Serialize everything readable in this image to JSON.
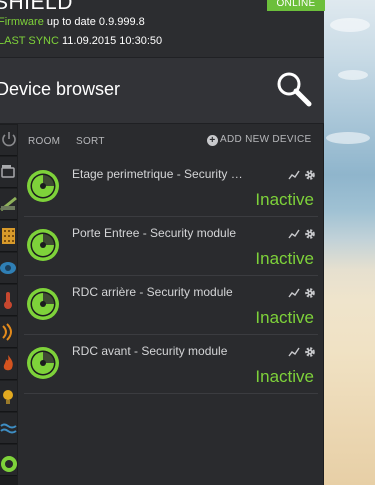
{
  "colors": {
    "accent_green": "#7ed23a",
    "badge_green": "#6cbf3b",
    "panel": "#2a2b2e"
  },
  "header": {
    "title": "SHIELD",
    "online_badge": "ONLINE",
    "firmware_label": "Firmware",
    "firmware_text": "up to date 0.9.999.8",
    "sync_label": "LAST SYNC",
    "sync_value": "11.09.2015 10:30:50"
  },
  "browser": {
    "title": "Device browser",
    "search_icon": "search-icon"
  },
  "sidebar": {
    "icons": [
      "power-icon",
      "camera-icon",
      "wall-icon",
      "keypad-icon",
      "eye-icon",
      "thermometer-icon",
      "signal-icon",
      "fire-icon",
      "light-icon",
      "water-icon",
      "ok-icon"
    ]
  },
  "toolbar": {
    "room_label": "ROOM",
    "sort_label": "SORT",
    "add_label": "ADD NEW DEVICE"
  },
  "devices": [
    {
      "name": "Etage perimetrique - Security module",
      "status": "Inactive"
    },
    {
      "name": "Porte Entree - Security module",
      "status": "Inactive"
    },
    {
      "name": "RDC arrière - Security module",
      "status": "Inactive"
    },
    {
      "name": "RDC avant - Security module",
      "status": "Inactive"
    }
  ]
}
